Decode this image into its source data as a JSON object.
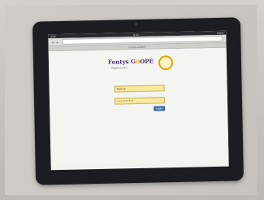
{
  "device": {
    "status_left": "iPad",
    "status_center": "9:41",
    "status_right": "100%"
  },
  "browser": {
    "title": "Fontys GOOPE",
    "url": "",
    "back_icon": "back-arrow-icon",
    "forward_icon": "forward-arrow-icon"
  },
  "logo": {
    "name_part1": "Fontys G",
    "name_o": "O",
    "name_part2": "OPE",
    "subtitle": "Hogescholen",
    "seal_icon": "sun-seal-icon"
  },
  "login": {
    "username_label": "",
    "username_value": "fontys",
    "password_label": "",
    "password_value": "••••••••••",
    "remember_label": "",
    "button_label": "Login"
  },
  "links": {
    "forgot": "",
    "help": ""
  }
}
